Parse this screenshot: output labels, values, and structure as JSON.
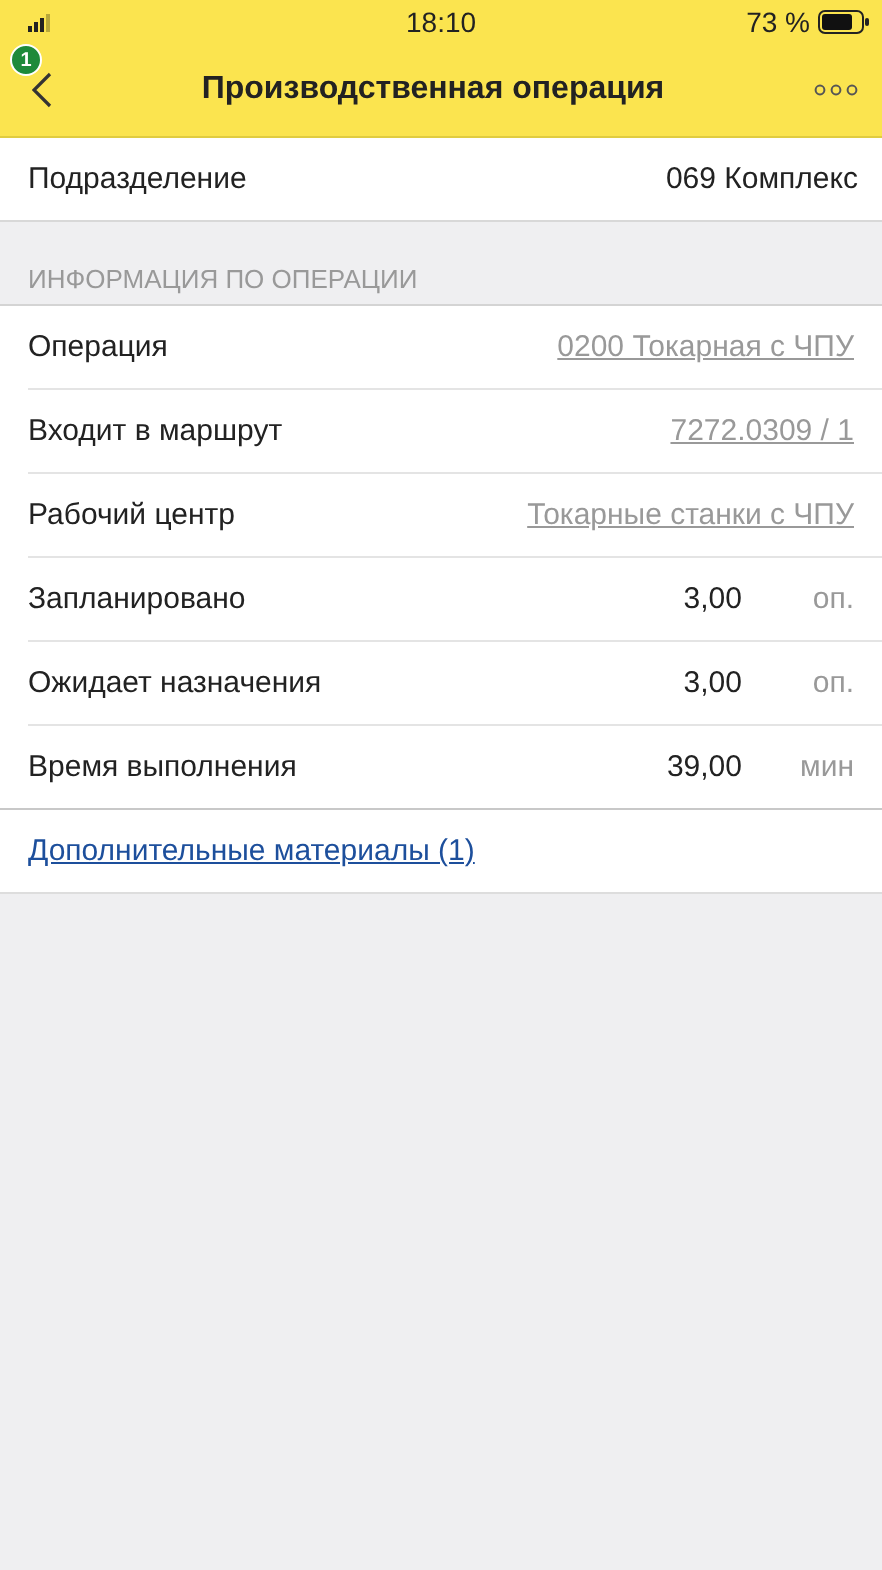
{
  "status_bar": {
    "time": "18:10",
    "battery": "73 %"
  },
  "header": {
    "badge": "1",
    "title": "Производственная операция"
  },
  "top_field": {
    "label": "Подразделение",
    "value": "069 Комплекс"
  },
  "section": {
    "title": "ИНФОРМАЦИЯ ПО ОПЕРАЦИИ",
    "rows": [
      {
        "kind": "link",
        "label": "Операция",
        "value": "0200 Токарная с ЧПУ"
      },
      {
        "kind": "link",
        "label": "Входит в маршрут",
        "value": "7272.0309 / 1"
      },
      {
        "kind": "link",
        "label": "Рабочий центр",
        "value": "Токарные станки с ЧПУ"
      },
      {
        "kind": "quantity",
        "label": "Запланировано",
        "value": "3,00",
        "unit": "оп."
      },
      {
        "kind": "quantity",
        "label": "Ожидает назначения",
        "value": "3,00",
        "unit": "оп."
      },
      {
        "kind": "quantity",
        "label": "Время выполнения",
        "value": "39,00",
        "unit": "мин"
      }
    ]
  },
  "extra_link": "Дополнительные материалы (1)"
}
